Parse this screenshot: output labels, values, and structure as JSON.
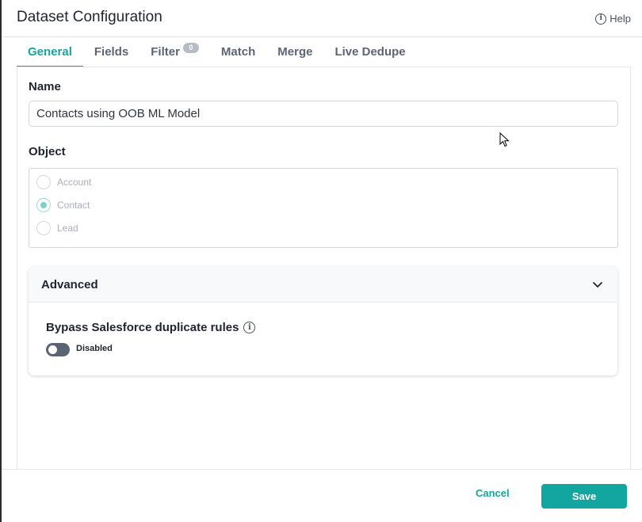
{
  "dialog": {
    "title": "Dataset Configuration",
    "help_label": "Help"
  },
  "tabs": [
    {
      "label": "General",
      "active": true
    },
    {
      "label": "Fields"
    },
    {
      "label": "Filter",
      "badge": "0"
    },
    {
      "label": "Match"
    },
    {
      "label": "Merge"
    },
    {
      "label": "Live Dedupe"
    }
  ],
  "form": {
    "name_label": "Name",
    "name_value": "Contacts using OOB ML Model",
    "object_label": "Object",
    "object_options": [
      {
        "label": "Account",
        "selected": false
      },
      {
        "label": "Contact",
        "selected": true
      },
      {
        "label": "Lead",
        "selected": false
      }
    ]
  },
  "advanced": {
    "title": "Advanced",
    "bypass_label": "Bypass Salesforce duplicate rules",
    "toggle_state": "Disabled"
  },
  "footer": {
    "cancel_label": "Cancel",
    "save_label": "Save"
  },
  "colors": {
    "accent": "#13a5a0",
    "toggle_off": "#5b6473"
  }
}
